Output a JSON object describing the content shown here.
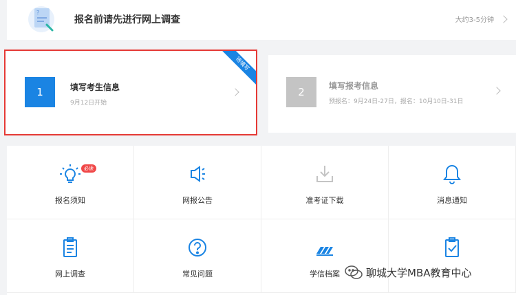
{
  "survey": {
    "title": "报名前请先进行网上调查",
    "duration": "大约3-5分钟",
    "icon": "survey-illustration-icon"
  },
  "steps": [
    {
      "number": "1",
      "title": "填写考生信息",
      "subtitle": "9月12日开始",
      "ribbon": "待填写",
      "state": "active",
      "accent": "#1a84e3"
    },
    {
      "number": "2",
      "title": "填写报考信息",
      "subtitle": "预报名：9月24日-27日，报名：10月10日-31日",
      "state": "disabled",
      "accent": "#c4c4c4"
    }
  ],
  "menu": [
    {
      "label": "报名须知",
      "icon": "lightbulb-icon",
      "badge": "必读",
      "enabled": true
    },
    {
      "label": "网报公告",
      "icon": "megaphone-icon",
      "enabled": true
    },
    {
      "label": "准考证下载",
      "icon": "download-icon",
      "enabled": false
    },
    {
      "label": "消息通知",
      "icon": "bell-icon",
      "enabled": true
    },
    {
      "label": "网上调查",
      "icon": "clipboard-icon",
      "enabled": true
    },
    {
      "label": "常见问题",
      "icon": "question-icon",
      "enabled": true
    },
    {
      "label": "学信档案",
      "icon": "archive-icon",
      "enabled": true
    },
    {
      "label": "",
      "icon": "checklist-icon",
      "enabled": true
    }
  ],
  "watermark": {
    "text": "聊城大学MBA教育中心",
    "icon": "wechat-icon"
  },
  "colors": {
    "primary": "#1a84e3",
    "highlight_border": "#e53935",
    "badge": "#f04848",
    "disabled": "#c4c4c4"
  }
}
